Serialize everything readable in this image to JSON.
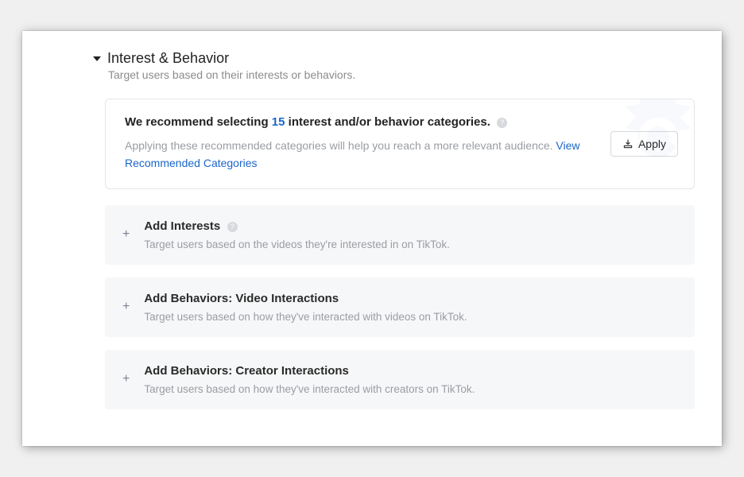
{
  "section": {
    "title": "Interest & Behavior",
    "subtitle": "Target users based on their interests or behaviors."
  },
  "recommendation": {
    "title_prefix": "We recommend selecting ",
    "count": "15",
    "title_suffix": " interest and/or behavior categories.",
    "description": "Applying these recommended categories will help you reach a more relevant audience. ",
    "link_label": "View Recommended Categories",
    "apply_label": "Apply"
  },
  "cards": [
    {
      "title": "Add Interests",
      "has_info": true,
      "subtitle": "Target users based on the videos they're interested in on TikTok."
    },
    {
      "title": "Add Behaviors: Video Interactions",
      "has_info": false,
      "subtitle": "Target users based on how they've interacted with videos on TikTok."
    },
    {
      "title": "Add Behaviors: Creator Interactions",
      "has_info": false,
      "subtitle": "Target users based on how they've interacted with creators on TikTok."
    }
  ]
}
